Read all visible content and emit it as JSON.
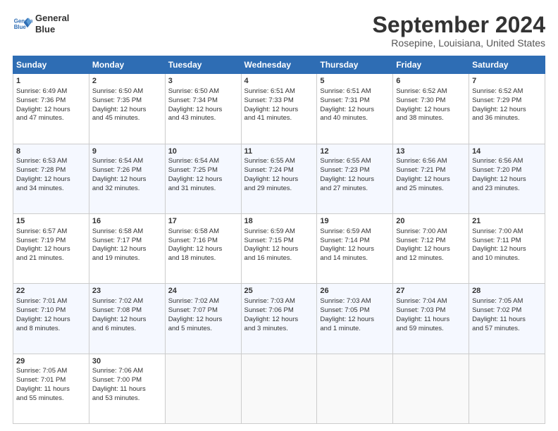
{
  "header": {
    "logo_line1": "General",
    "logo_line2": "Blue",
    "title": "September 2024",
    "location": "Rosepine, Louisiana, United States"
  },
  "days_of_week": [
    "Sunday",
    "Monday",
    "Tuesday",
    "Wednesday",
    "Thursday",
    "Friday",
    "Saturday"
  ],
  "weeks": [
    [
      {
        "num": "1",
        "lines": [
          "Sunrise: 6:49 AM",
          "Sunset: 7:36 PM",
          "Daylight: 12 hours",
          "and 47 minutes."
        ]
      },
      {
        "num": "2",
        "lines": [
          "Sunrise: 6:50 AM",
          "Sunset: 7:35 PM",
          "Daylight: 12 hours",
          "and 45 minutes."
        ]
      },
      {
        "num": "3",
        "lines": [
          "Sunrise: 6:50 AM",
          "Sunset: 7:34 PM",
          "Daylight: 12 hours",
          "and 43 minutes."
        ]
      },
      {
        "num": "4",
        "lines": [
          "Sunrise: 6:51 AM",
          "Sunset: 7:33 PM",
          "Daylight: 12 hours",
          "and 41 minutes."
        ]
      },
      {
        "num": "5",
        "lines": [
          "Sunrise: 6:51 AM",
          "Sunset: 7:31 PM",
          "Daylight: 12 hours",
          "and 40 minutes."
        ]
      },
      {
        "num": "6",
        "lines": [
          "Sunrise: 6:52 AM",
          "Sunset: 7:30 PM",
          "Daylight: 12 hours",
          "and 38 minutes."
        ]
      },
      {
        "num": "7",
        "lines": [
          "Sunrise: 6:52 AM",
          "Sunset: 7:29 PM",
          "Daylight: 12 hours",
          "and 36 minutes."
        ]
      }
    ],
    [
      {
        "num": "8",
        "lines": [
          "Sunrise: 6:53 AM",
          "Sunset: 7:28 PM",
          "Daylight: 12 hours",
          "and 34 minutes."
        ]
      },
      {
        "num": "9",
        "lines": [
          "Sunrise: 6:54 AM",
          "Sunset: 7:26 PM",
          "Daylight: 12 hours",
          "and 32 minutes."
        ]
      },
      {
        "num": "10",
        "lines": [
          "Sunrise: 6:54 AM",
          "Sunset: 7:25 PM",
          "Daylight: 12 hours",
          "and 31 minutes."
        ]
      },
      {
        "num": "11",
        "lines": [
          "Sunrise: 6:55 AM",
          "Sunset: 7:24 PM",
          "Daylight: 12 hours",
          "and 29 minutes."
        ]
      },
      {
        "num": "12",
        "lines": [
          "Sunrise: 6:55 AM",
          "Sunset: 7:23 PM",
          "Daylight: 12 hours",
          "and 27 minutes."
        ]
      },
      {
        "num": "13",
        "lines": [
          "Sunrise: 6:56 AM",
          "Sunset: 7:21 PM",
          "Daylight: 12 hours",
          "and 25 minutes."
        ]
      },
      {
        "num": "14",
        "lines": [
          "Sunrise: 6:56 AM",
          "Sunset: 7:20 PM",
          "Daylight: 12 hours",
          "and 23 minutes."
        ]
      }
    ],
    [
      {
        "num": "15",
        "lines": [
          "Sunrise: 6:57 AM",
          "Sunset: 7:19 PM",
          "Daylight: 12 hours",
          "and 21 minutes."
        ]
      },
      {
        "num": "16",
        "lines": [
          "Sunrise: 6:58 AM",
          "Sunset: 7:17 PM",
          "Daylight: 12 hours",
          "and 19 minutes."
        ]
      },
      {
        "num": "17",
        "lines": [
          "Sunrise: 6:58 AM",
          "Sunset: 7:16 PM",
          "Daylight: 12 hours",
          "and 18 minutes."
        ]
      },
      {
        "num": "18",
        "lines": [
          "Sunrise: 6:59 AM",
          "Sunset: 7:15 PM",
          "Daylight: 12 hours",
          "and 16 minutes."
        ]
      },
      {
        "num": "19",
        "lines": [
          "Sunrise: 6:59 AM",
          "Sunset: 7:14 PM",
          "Daylight: 12 hours",
          "and 14 minutes."
        ]
      },
      {
        "num": "20",
        "lines": [
          "Sunrise: 7:00 AM",
          "Sunset: 7:12 PM",
          "Daylight: 12 hours",
          "and 12 minutes."
        ]
      },
      {
        "num": "21",
        "lines": [
          "Sunrise: 7:00 AM",
          "Sunset: 7:11 PM",
          "Daylight: 12 hours",
          "and 10 minutes."
        ]
      }
    ],
    [
      {
        "num": "22",
        "lines": [
          "Sunrise: 7:01 AM",
          "Sunset: 7:10 PM",
          "Daylight: 12 hours",
          "and 8 minutes."
        ]
      },
      {
        "num": "23",
        "lines": [
          "Sunrise: 7:02 AM",
          "Sunset: 7:08 PM",
          "Daylight: 12 hours",
          "and 6 minutes."
        ]
      },
      {
        "num": "24",
        "lines": [
          "Sunrise: 7:02 AM",
          "Sunset: 7:07 PM",
          "Daylight: 12 hours",
          "and 5 minutes."
        ]
      },
      {
        "num": "25",
        "lines": [
          "Sunrise: 7:03 AM",
          "Sunset: 7:06 PM",
          "Daylight: 12 hours",
          "and 3 minutes."
        ]
      },
      {
        "num": "26",
        "lines": [
          "Sunrise: 7:03 AM",
          "Sunset: 7:05 PM",
          "Daylight: 12 hours",
          "and 1 minute."
        ]
      },
      {
        "num": "27",
        "lines": [
          "Sunrise: 7:04 AM",
          "Sunset: 7:03 PM",
          "Daylight: 11 hours",
          "and 59 minutes."
        ]
      },
      {
        "num": "28",
        "lines": [
          "Sunrise: 7:05 AM",
          "Sunset: 7:02 PM",
          "Daylight: 11 hours",
          "and 57 minutes."
        ]
      }
    ],
    [
      {
        "num": "29",
        "lines": [
          "Sunrise: 7:05 AM",
          "Sunset: 7:01 PM",
          "Daylight: 11 hours",
          "and 55 minutes."
        ]
      },
      {
        "num": "30",
        "lines": [
          "Sunrise: 7:06 AM",
          "Sunset: 7:00 PM",
          "Daylight: 11 hours",
          "and 53 minutes."
        ]
      },
      null,
      null,
      null,
      null,
      null
    ]
  ]
}
